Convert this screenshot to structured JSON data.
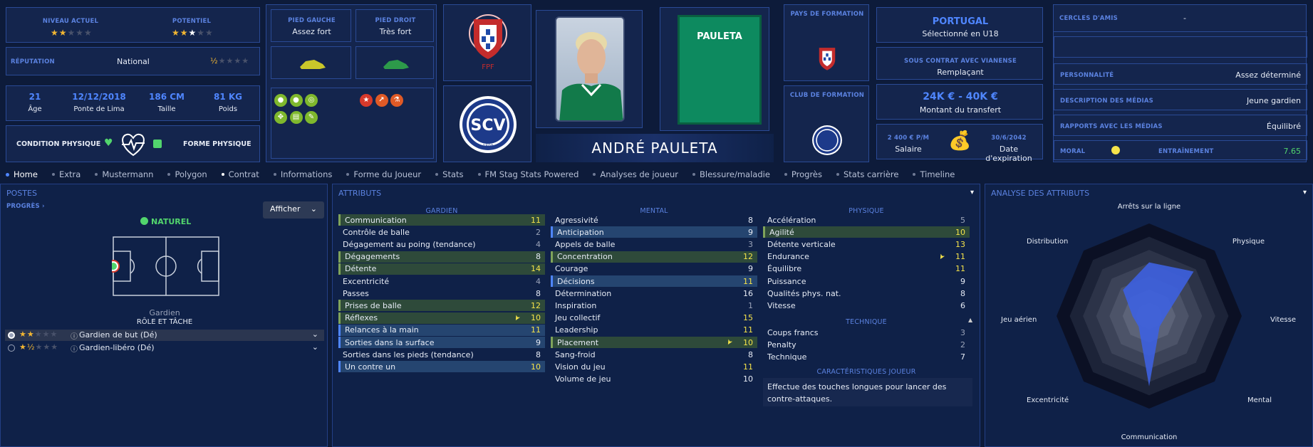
{
  "top": {
    "niveau_label": "NIVEAU ACTUEL",
    "potentiel_label": "POTENTIEL",
    "reputation_label": "RÉPUTATION",
    "reputation_value": "National",
    "age": "21",
    "age_label": "Âge",
    "dob": "12/12/2018",
    "birthplace": "Ponte de Lima",
    "height": "186 CM",
    "height_label": "Taille",
    "weight": "81 KG",
    "weight_label": "Poids",
    "condition_label": "CONDITION PHYSIQUE",
    "forme_label": "FORME PHYSIQUE",
    "pied_gauche_label": "PIED GAUCHE",
    "pied_gauche_value": "Assez fort",
    "pied_droit_label": "PIED DROIT",
    "pied_droit_value": "Très fort",
    "player_name": "ANDRÉ PAULETA",
    "shirt_name": "PAULETA",
    "pays_formation_label": "PAYS DE FORMATION",
    "club_formation_label": "CLUB DE FORMATION",
    "nation": "PORTUGAL",
    "nation_sub": "Sélectionné en U18",
    "contrat_label": "SOUS CONTRAT AVEC VIANENSE",
    "contrat_value": "Remplaçant",
    "transfer_value": "24K € - 40K €",
    "transfer_label": "Montant du transfert",
    "salary": "2 400 € P/M",
    "salary_label": "Salaire",
    "expiry": "30/6/2042",
    "expiry_label": "Date d'expiration",
    "cercles_label": "CERCLES D'AMIS",
    "cercles_value": "-",
    "personnalite_label": "PERSONNALITÉ",
    "personnalite_value": "Assez déterminé",
    "description_label": "DESCRIPTION DES MÉDIAS",
    "description_value": "Jeune gardien",
    "rapports_label": "RAPPORTS AVEC LES MÉDIAS",
    "rapports_value": "Équilibré",
    "moral_label": "MORAL",
    "entrainement_label": "ENTRAÎNEMENT",
    "entrainement_value": "7.65",
    "crest_text": "SCV",
    "crest_year": "1898",
    "colors": {
      "accent": "#4f86ff",
      "green": "#52d56d",
      "gold": "#f2b632"
    }
  },
  "tabs": [
    "Home",
    "Extra",
    "Mustermann",
    "Polygon",
    "Contrat",
    "Informations",
    "Forme du Joueur",
    "Stats",
    "FM Stag Stats Powered",
    "Analyses de joueur",
    "Blessure/maladie",
    "Progrès",
    "Stats carrière",
    "Timeline"
  ],
  "postes": {
    "title": "POSTES",
    "progres": "PROGRÈS",
    "afficher": "Afficher",
    "naturel": "NATUREL",
    "position": "Gardien",
    "role_title": "RÔLE ET TÂCHE",
    "roles": [
      {
        "label": "Gardien de but (Dé)"
      },
      {
        "label": "Gardien-libéro (Dé)"
      }
    ]
  },
  "attributs": {
    "title": "ATTRIBUTS",
    "gardien_h": "GARDIEN",
    "mental_h": "MENTAL",
    "physique_h": "PHYSIQUE",
    "technique_h": "TECHNIQUE",
    "carac_h": "CARACTÉRISTIQUES JOUEUR",
    "carac_text_1": "Effectue des touches longues pour lancer des",
    "carac_text_2": "contre-attaques.",
    "gardien": [
      [
        "Communication",
        "11"
      ],
      [
        "Contrôle de balle",
        "2"
      ],
      [
        "Dégagement au poing (tendance)",
        "4"
      ],
      [
        "Dégagements",
        "8"
      ],
      [
        "Détente",
        "14"
      ],
      [
        "Excentricité",
        "4"
      ],
      [
        "Passes",
        "8"
      ],
      [
        "Prises de balle",
        "12"
      ],
      [
        "Réflexes",
        "10"
      ],
      [
        "Relances à la main",
        "11"
      ],
      [
        "Sorties dans la surface",
        "9"
      ],
      [
        "Sorties dans les pieds (tendance)",
        "8"
      ],
      [
        "Un contre un",
        "10"
      ]
    ],
    "mental": [
      [
        "Agressivité",
        "8"
      ],
      [
        "Anticipation",
        "9"
      ],
      [
        "Appels de balle",
        "3"
      ],
      [
        "Concentration",
        "12"
      ],
      [
        "Courage",
        "9"
      ],
      [
        "Décisions",
        "11"
      ],
      [
        "Détermination",
        "16"
      ],
      [
        "Inspiration",
        "1"
      ],
      [
        "Jeu collectif",
        "15"
      ],
      [
        "Leadership",
        "11"
      ],
      [
        "Placement",
        "10"
      ],
      [
        "Sang-froid",
        "8"
      ],
      [
        "Vision du jeu",
        "11"
      ],
      [
        "Volume de jeu",
        "10"
      ]
    ],
    "physique": [
      [
        "Accélération",
        "5"
      ],
      [
        "Agilité",
        "10"
      ],
      [
        "Détente verticale",
        "13"
      ],
      [
        "Endurance",
        "11"
      ],
      [
        "Équilibre",
        "11"
      ],
      [
        "Puissance",
        "9"
      ],
      [
        "Qualités phys. nat.",
        "8"
      ],
      [
        "Vitesse",
        "6"
      ]
    ],
    "technique": [
      [
        "Coups francs",
        "3"
      ],
      [
        "Penalty",
        "2"
      ],
      [
        "Technique",
        "7"
      ]
    ]
  },
  "analyse": {
    "title": "ANALYSE DES ATTRIBUTS",
    "labels": [
      "Arrêts sur la ligne",
      "Physique",
      "Vitesse",
      "Mental",
      "Communication",
      "Excentricité",
      "Jeu aérien",
      "Distribution"
    ]
  }
}
